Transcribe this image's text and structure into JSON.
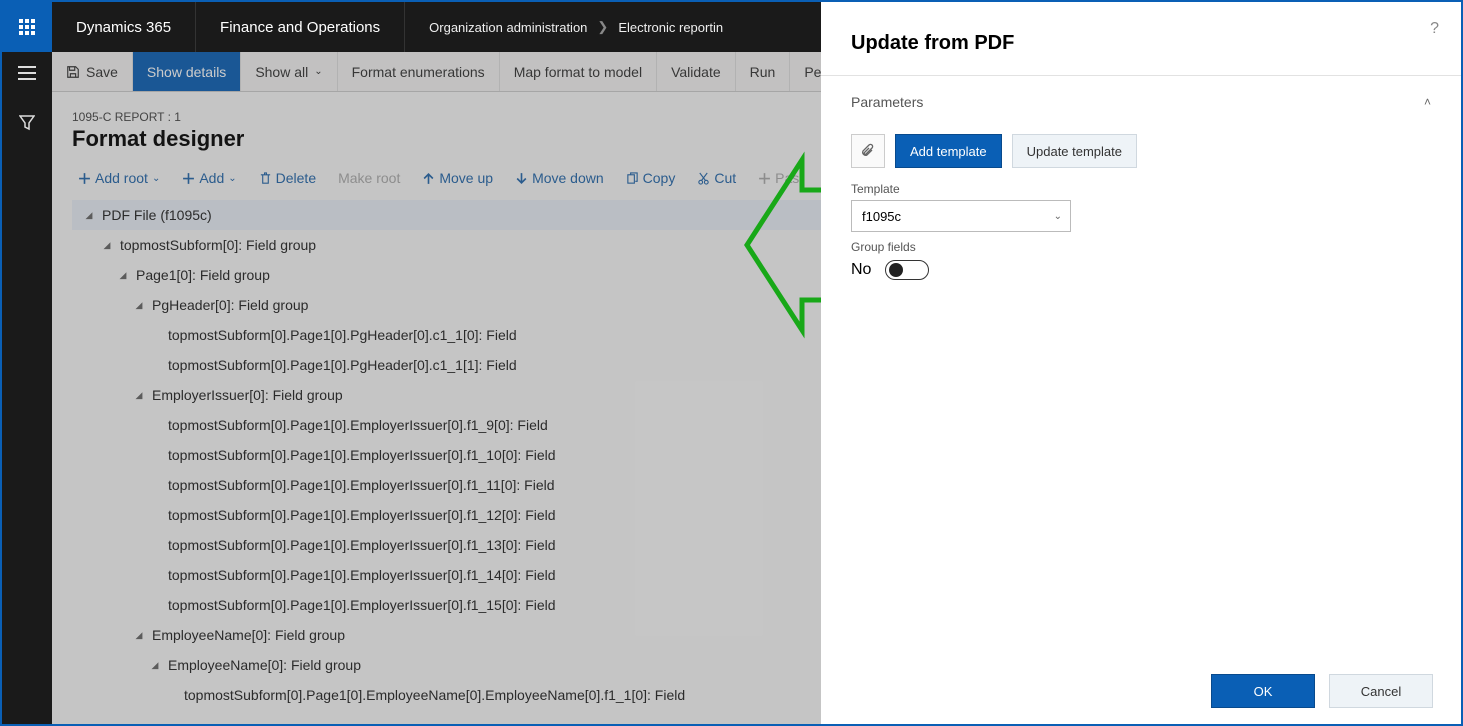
{
  "topnav": {
    "brand": "Dynamics 365",
    "module": "Finance and Operations",
    "crumb1": "Organization administration",
    "crumb2": "Electronic reportin"
  },
  "actionbar": {
    "save": "Save",
    "show_details": "Show details",
    "show_all": "Show all",
    "format_enum": "Format enumerations",
    "map": "Map format to model",
    "validate": "Validate",
    "run": "Run",
    "perf": "Performa"
  },
  "page": {
    "sub": "1095-C REPORT : 1",
    "title": "Format designer"
  },
  "treetoolbar": {
    "add_root": "Add root",
    "add": "Add",
    "delete": "Delete",
    "make_root": "Make root",
    "move_up": "Move up",
    "move_down": "Move down",
    "copy": "Copy",
    "cut": "Cut",
    "paste": "Pas"
  },
  "tree": [
    {
      "indent": 10,
      "label": "PDF File (f1095c)",
      "sel": true
    },
    {
      "indent": 28,
      "label": "topmostSubform[0]: Field group"
    },
    {
      "indent": 44,
      "label": "Page1[0]: Field group"
    },
    {
      "indent": 60,
      "label": "PgHeader[0]: Field group"
    },
    {
      "indent": 76,
      "leaf": true,
      "label": "topmostSubform[0].Page1[0].PgHeader[0].c1_1[0]: Field"
    },
    {
      "indent": 76,
      "leaf": true,
      "label": "topmostSubform[0].Page1[0].PgHeader[0].c1_1[1]: Field"
    },
    {
      "indent": 60,
      "label": "EmployerIssuer[0]: Field group"
    },
    {
      "indent": 76,
      "leaf": true,
      "label": "topmostSubform[0].Page1[0].EmployerIssuer[0].f1_9[0]: Field"
    },
    {
      "indent": 76,
      "leaf": true,
      "label": "topmostSubform[0].Page1[0].EmployerIssuer[0].f1_10[0]: Field"
    },
    {
      "indent": 76,
      "leaf": true,
      "label": "topmostSubform[0].Page1[0].EmployerIssuer[0].f1_11[0]: Field"
    },
    {
      "indent": 76,
      "leaf": true,
      "label": "topmostSubform[0].Page1[0].EmployerIssuer[0].f1_12[0]: Field"
    },
    {
      "indent": 76,
      "leaf": true,
      "label": "topmostSubform[0].Page1[0].EmployerIssuer[0].f1_13[0]: Field"
    },
    {
      "indent": 76,
      "leaf": true,
      "label": "topmostSubform[0].Page1[0].EmployerIssuer[0].f1_14[0]: Field"
    },
    {
      "indent": 76,
      "leaf": true,
      "label": "topmostSubform[0].Page1[0].EmployerIssuer[0].f1_15[0]: Field"
    },
    {
      "indent": 60,
      "label": "EmployeeName[0]: Field group"
    },
    {
      "indent": 76,
      "label": "EmployeeName[0]: Field group"
    },
    {
      "indent": 92,
      "leaf": true,
      "label": "topmostSubform[0].Page1[0].EmployeeName[0].EmployeeName[0].f1_1[0]: Field"
    }
  ],
  "panel": {
    "title": "Update from PDF",
    "section": "Parameters",
    "add_template": "Add template",
    "update_template": "Update template",
    "template_label": "Template",
    "template_value": "f1095c",
    "group_fields_label": "Group fields",
    "group_fields_value": "No",
    "ok": "OK",
    "cancel": "Cancel"
  }
}
